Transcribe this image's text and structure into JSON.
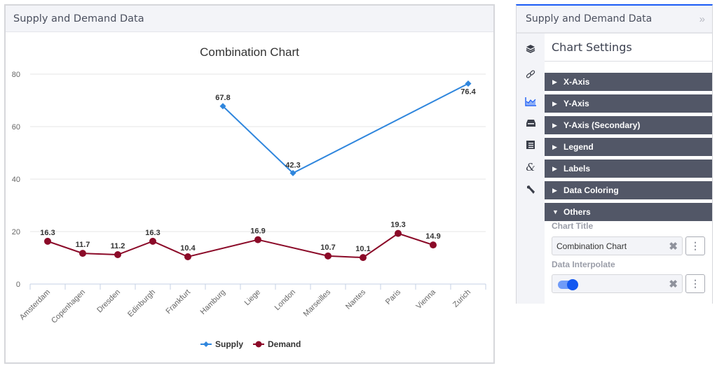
{
  "chart_panel": {
    "header_title": "Supply and Demand Data"
  },
  "chart_data": {
    "type": "line",
    "title": "Combination Chart",
    "xlabel": "",
    "ylabel": "",
    "ylim": [
      0,
      80
    ],
    "yticks": [
      "0",
      "20",
      "40",
      "60",
      "80"
    ],
    "grid": true,
    "legend_position": "bottom",
    "categories": [
      "Amsterdam",
      "Copenhagen",
      "Dresden",
      "Edinburgh",
      "Frankfurt",
      "Hamburg",
      "Liege",
      "London",
      "Marseilles",
      "Nantes",
      "Paris",
      "Vienna",
      "Zurich"
    ],
    "series": [
      {
        "name": "Supply",
        "color": "#2f86dd",
        "marker": "diamond",
        "values": [
          null,
          null,
          null,
          null,
          null,
          67.8,
          null,
          42.3,
          null,
          null,
          null,
          null,
          76.4
        ],
        "labels": [
          null,
          null,
          null,
          null,
          null,
          "67.8",
          null,
          "42.3",
          null,
          null,
          null,
          null,
          "76.4"
        ],
        "interpolate": true
      },
      {
        "name": "Demand",
        "color": "#8b0a28",
        "marker": "circle",
        "values": [
          16.3,
          11.7,
          11.2,
          16.3,
          10.4,
          null,
          16.9,
          null,
          10.7,
          10.1,
          19.3,
          14.9,
          null
        ],
        "labels": [
          "16.3",
          "11.7",
          "11.2",
          "16.3",
          "10.4",
          null,
          "16.9",
          null,
          "10.7",
          "10.1",
          "19.3",
          "14.9",
          null
        ],
        "interpolate": true
      }
    ]
  },
  "settings_panel": {
    "header_title": "Supply and Demand Data",
    "collapse_glyph": "»",
    "title": "Chart Settings",
    "rail_icons": [
      "layers-icon",
      "link-icon",
      "chart-area-icon",
      "inbox-icon",
      "document-icon",
      "ampersand-icon",
      "wrench-icon"
    ],
    "active_rail_icon": "chart-area-icon",
    "sections": [
      {
        "label": "X-Axis",
        "expanded": false
      },
      {
        "label": "Y-Axis",
        "expanded": false
      },
      {
        "label": "Y-Axis (Secondary)",
        "expanded": false
      },
      {
        "label": "Legend",
        "expanded": false
      },
      {
        "label": "Labels",
        "expanded": false
      },
      {
        "label": "Data Coloring",
        "expanded": false
      },
      {
        "label": "Others",
        "expanded": true
      }
    ],
    "others": {
      "chart_title_label": "Chart Title",
      "chart_title_value": "Combination Chart",
      "data_interpolate_label": "Data Interpolate",
      "data_interpolate_value": true
    },
    "arrow_collapsed": "▶",
    "arrow_expanded": "▼",
    "clear_glyph": "✖",
    "more_glyph": "⋮"
  }
}
